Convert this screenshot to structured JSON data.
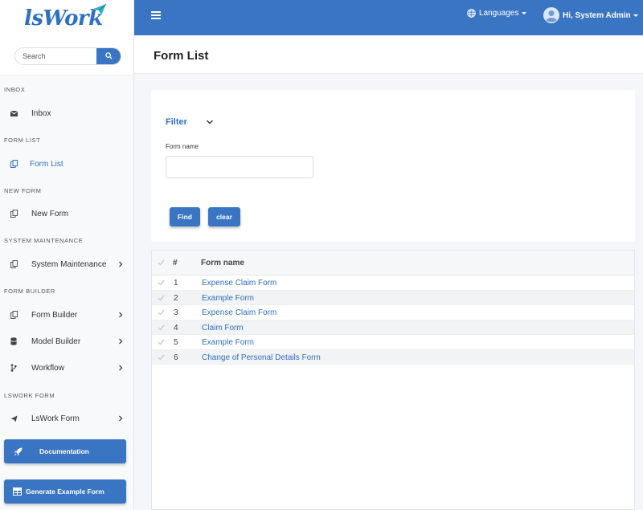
{
  "app": {
    "logo_text": "lsWork",
    "search_placeholder": "Search"
  },
  "sidebar": {
    "sections": [
      {
        "label": "INBOX",
        "items": [
          {
            "label": "Inbox",
            "icon": "envelope-icon",
            "has_chevron": false
          }
        ]
      },
      {
        "label": "FORM LIST",
        "items": [
          {
            "label": "Form List",
            "icon": "copy-icon",
            "has_chevron": false,
            "active": true
          }
        ]
      },
      {
        "label": "NEW FORM",
        "items": [
          {
            "label": "New Form",
            "icon": "copy-icon",
            "has_chevron": false
          }
        ]
      },
      {
        "label": "SYSTEM MAINTENANCE",
        "items": [
          {
            "label": "System Maintenance",
            "icon": "copy-icon",
            "has_chevron": true
          }
        ]
      },
      {
        "label": "FORM BUILDER",
        "items": [
          {
            "label": "Form Builder",
            "icon": "copy-icon",
            "has_chevron": true
          },
          {
            "label": "Model Builder",
            "icon": "database-icon",
            "has_chevron": true
          },
          {
            "label": "Workflow",
            "icon": "branch-icon",
            "has_chevron": true
          }
        ]
      },
      {
        "label": "LSWORK FORM",
        "items": [
          {
            "label": "LsWork Form",
            "icon": "paper-plane-icon",
            "has_chevron": true
          }
        ]
      }
    ],
    "buttons": {
      "documentation": "Documentation",
      "generate_example": "Generate Example Form"
    }
  },
  "topbar": {
    "languages_label": "Languages",
    "user_label": "Hi, System Admin"
  },
  "page": {
    "title": "Form List"
  },
  "filter": {
    "title": "Filter",
    "form_name_label": "Form name",
    "form_name_value": "",
    "find_label": "Find",
    "clear_label": "clear"
  },
  "table": {
    "headers": {
      "index": "#",
      "form_name": "Form name"
    },
    "rows": [
      {
        "index": "1",
        "form_name": "Expense Claim Form"
      },
      {
        "index": "2",
        "form_name": "Example Form"
      },
      {
        "index": "3",
        "form_name": "Expense Claim Form"
      },
      {
        "index": "4",
        "form_name": "Claim Form"
      },
      {
        "index": "5",
        "form_name": "Example Form"
      },
      {
        "index": "6",
        "form_name": "Change of Personal Details Form"
      }
    ]
  },
  "colors": {
    "primary": "#3a75c4",
    "link": "#2f6fc4"
  }
}
